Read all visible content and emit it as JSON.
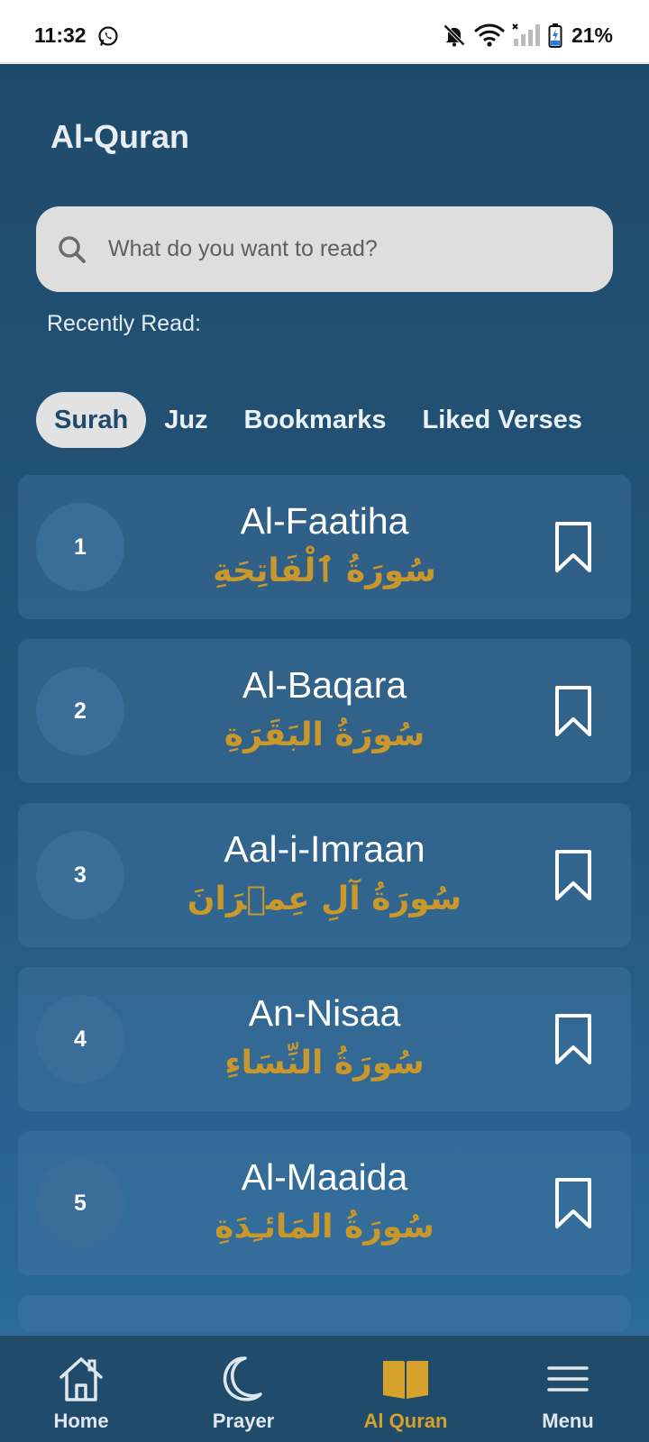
{
  "status_bar": {
    "time": "11:32",
    "battery": "21%",
    "icons": [
      "whatsapp-icon",
      "bell-muted-icon",
      "wifi-icon",
      "signal-icon",
      "battery-icon"
    ]
  },
  "header": {
    "title": "Al-Quran"
  },
  "search": {
    "placeholder": "What do you want to read?",
    "value": ""
  },
  "recent": {
    "label": "Recently Read:"
  },
  "tabs": [
    {
      "label": "Surah",
      "active": true
    },
    {
      "label": "Juz",
      "active": false
    },
    {
      "label": "Bookmarks",
      "active": false
    },
    {
      "label": "Liked Verses",
      "active": false
    }
  ],
  "surahs": [
    {
      "number": "1",
      "name": "Al-Faatiha",
      "arabic": "سُورَةُ ٱلْفَاتِحَةِ"
    },
    {
      "number": "2",
      "name": "Al-Baqara",
      "arabic": "سُورَةُ البَقَرَةِ"
    },
    {
      "number": "3",
      "name": "Aal-i-Imraan",
      "arabic": "سُورَةُ آلِ عِمۡرَانَ"
    },
    {
      "number": "4",
      "name": "An-Nisaa",
      "arabic": "سُورَةُ النِّسَاءِ"
    },
    {
      "number": "5",
      "name": "Al-Maaida",
      "arabic": "سُورَةُ المَائـِدَةِ"
    }
  ],
  "bottom_nav": [
    {
      "label": "Home",
      "icon": "home-icon",
      "active": false
    },
    {
      "label": "Prayer",
      "icon": "moon-icon",
      "active": false
    },
    {
      "label": "Al Quran",
      "icon": "book-icon",
      "active": true
    },
    {
      "label": "Menu",
      "icon": "menu-icon",
      "active": false
    }
  ],
  "colors": {
    "background": "#1f4b6b",
    "accent_gold": "#c9972a",
    "active_nav": "#d7a22c",
    "tab_active_bg": "#e2e2e2"
  }
}
